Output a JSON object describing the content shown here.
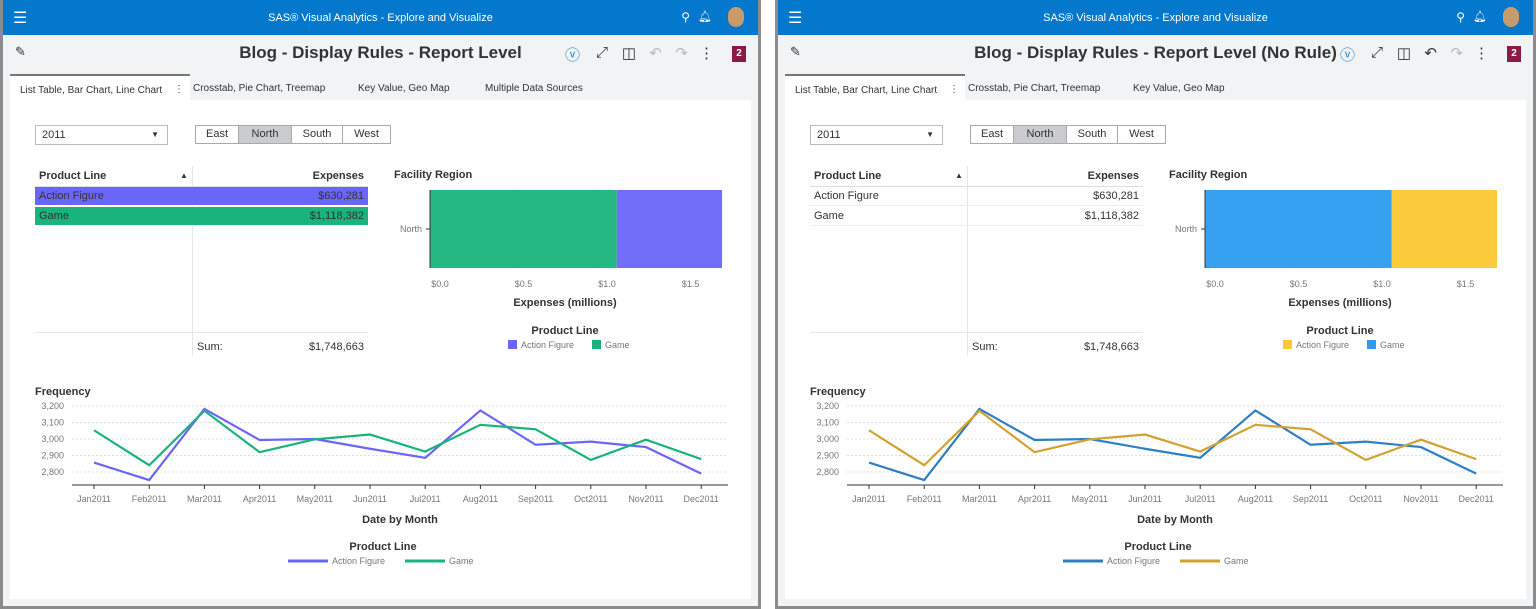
{
  "app_title": "SAS® Visual Analytics - Explore and Visualize",
  "colors": {
    "app_bar": "#0378cd",
    "badge": "#8b1a47"
  },
  "panels": [
    {
      "report_title": "Blog - Display Rules - Report Level",
      "tabs": [
        "List Table, Bar Chart, Line Chart",
        "Crosstab, Pie Chart, Treemap",
        "Key Value, Geo Map",
        "Multiple Data Sources"
      ],
      "active_tab": 0,
      "badge": "2",
      "year_select": "2011",
      "regions": [
        "East",
        "North",
        "South",
        "West"
      ],
      "selected_region": "North",
      "table": {
        "headers": [
          "Product Line",
          "Expenses"
        ],
        "rows": [
          [
            "Action Figure",
            "$630,281"
          ],
          [
            "Game",
            "$1,118,382"
          ]
        ],
        "sum_label": "Sum:",
        "sum_value": "$1,748,663",
        "row_colors": [
          "#6b66fa",
          "#19b37b"
        ]
      },
      "chart_index": [
        0,
        1
      ]
    },
    {
      "report_title": "Blog - Display Rules - Report Level (No Rule)",
      "tabs": [
        "List Table, Bar Chart, Line Chart",
        "Crosstab, Pie Chart, Treemap",
        "Key Value, Geo Map"
      ],
      "active_tab": 0,
      "badge": "2",
      "year_select": "2011",
      "regions": [
        "East",
        "North",
        "South",
        "West"
      ],
      "selected_region": "North",
      "table": {
        "headers": [
          "Product Line",
          "Expenses"
        ],
        "rows": [
          [
            "Action Figure",
            "$630,281"
          ],
          [
            "Game",
            "$1,118,382"
          ]
        ],
        "sum_label": "Sum:",
        "sum_value": "$1,748,663",
        "row_colors": [
          null,
          null
        ]
      },
      "chart_index": [
        2,
        3
      ]
    }
  ],
  "chart_data": [
    {
      "type": "bar",
      "orientation": "horizontal",
      "stacked": true,
      "title": "Facility Region",
      "categories": [
        "North"
      ],
      "xlabel": "Expenses (millions)",
      "xlim": [
        0,
        1.75
      ],
      "ticks": [
        "$0.0",
        "$0.5",
        "$1.0",
        "$1.5"
      ],
      "tick_values": [
        0,
        0.5,
        1.0,
        1.5
      ],
      "legend_title": "Product Line",
      "legend": "bottom",
      "series": [
        {
          "name": "Game",
          "values": [
            1.118382
          ],
          "color": "#19b37b"
        },
        {
          "name": "Action Figure",
          "values": [
            0.630281
          ],
          "color": "#6b66fa"
        }
      ],
      "legend_order": [
        "Action Figure",
        "Game"
      ]
    },
    {
      "type": "line",
      "title": "Frequency",
      "xlabel": "Date by Month",
      "ylim": [
        2750,
        3200
      ],
      "yticks": [
        "2,800",
        "2,900",
        "3,000",
        "3,100",
        "3,200"
      ],
      "ytick_values": [
        2800,
        2900,
        3000,
        3100,
        3200
      ],
      "grid": true,
      "legend_title": "Product Line",
      "legend": "bottom",
      "categories": [
        "Jan2011",
        "Feb2011",
        "Mar2011",
        "Apr2011",
        "May2011",
        "Jun2011",
        "Jul2011",
        "Aug2011",
        "Sep2011",
        "Oct2011",
        "Nov2011",
        "Dec2011"
      ],
      "series": [
        {
          "name": "Action Figure",
          "color": "#6b66fa",
          "values": [
            2857,
            2751,
            3182,
            2994,
            3000,
            2941,
            2886,
            3173,
            2965,
            2984,
            2951,
            2790
          ]
        },
        {
          "name": "Game",
          "color": "#19b37b",
          "values": [
            3053,
            2841,
            3171,
            2920,
            2998,
            3027,
            2924,
            3086,
            3059,
            2873,
            2996,
            2878
          ]
        }
      ]
    },
    {
      "type": "bar",
      "orientation": "horizontal",
      "stacked": true,
      "title": "Facility Region",
      "categories": [
        "North"
      ],
      "xlabel": "Expenses (millions)",
      "xlim": [
        0,
        1.75
      ],
      "ticks": [
        "$0.0",
        "$0.5",
        "$1.0",
        "$1.5"
      ],
      "tick_values": [
        0,
        0.5,
        1.0,
        1.5
      ],
      "legend_title": "Product Line",
      "legend": "bottom",
      "series": [
        {
          "name": "Game",
          "values": [
            1.118382
          ],
          "color": "#2c9cf0"
        },
        {
          "name": "Action Figure",
          "values": [
            0.630281
          ],
          "color": "#fbc832"
        }
      ],
      "legend_order": [
        "Action Figure",
        "Game"
      ]
    },
    {
      "type": "line",
      "title": "Frequency",
      "xlabel": "Date by Month",
      "ylim": [
        2750,
        3200
      ],
      "yticks": [
        "2,800",
        "2,900",
        "3,000",
        "3,100",
        "3,200"
      ],
      "ytick_values": [
        2800,
        2900,
        3000,
        3100,
        3200
      ],
      "grid": true,
      "legend_title": "Product Line",
      "legend": "bottom",
      "categories": [
        "Jan2011",
        "Feb2011",
        "Mar2011",
        "Apr2011",
        "May2011",
        "Jun2011",
        "Jul2011",
        "Aug2011",
        "Sep2011",
        "Oct2011",
        "Nov2011",
        "Dec2011"
      ],
      "series": [
        {
          "name": "Action Figure",
          "color": "#2e7fc4",
          "values": [
            2857,
            2751,
            3182,
            2994,
            3000,
            2941,
            2886,
            3173,
            2965,
            2984,
            2951,
            2790
          ]
        },
        {
          "name": "Game",
          "color": "#d4a030",
          "values": [
            3053,
            2841,
            3171,
            2920,
            2998,
            3027,
            2924,
            3086,
            3059,
            2873,
            2996,
            2878
          ]
        }
      ]
    }
  ]
}
